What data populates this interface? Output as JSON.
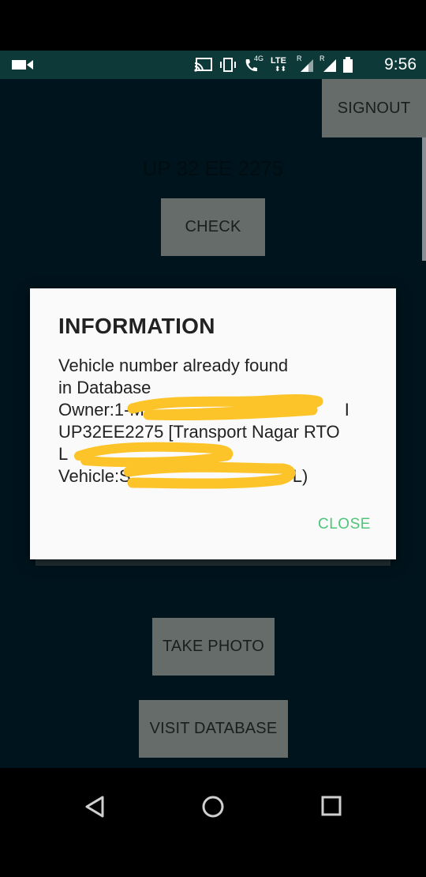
{
  "status_bar": {
    "time": "9:56",
    "icons": [
      "video-camera-icon",
      "cast-icon",
      "vibrate-icon",
      "call-4g-icon",
      "lte-icon",
      "signal-icon",
      "signal-icon",
      "battery-icon"
    ],
    "network_labels": {
      "call": "4G",
      "lte": "LTE",
      "roaming1": "R",
      "roaming2": "R"
    }
  },
  "header": {
    "signout_label": "SIGNOUT"
  },
  "form": {
    "vehicle_number": "UP 32 EE 2275",
    "check_label": "CHECK"
  },
  "dialog": {
    "title": "INFORMATION",
    "lines": [
      "Vehicle number already found",
      "in Database",
      "Owner:1-M",
      "UP32EE2275 [Transport Nagar RTO",
      "L",
      "Vehicle:S"
    ],
    "owner_tail": "I",
    "vehicle_tail": "L)",
    "close_label": "CLOSE"
  },
  "actions": {
    "take_photo_label": "TAKE PHOTO",
    "visit_database_label": "VISIT DATABASE"
  },
  "nav_bar": {
    "back": "back-triangle-icon",
    "home": "home-circle-icon",
    "recents": "recents-square-icon"
  },
  "colors": {
    "status_bar": "#0d3a38",
    "app_background": "#00141d",
    "button": "#656c69",
    "dialog": "#fafafa",
    "close_text": "#4fc47a",
    "redaction": "#fdc42a"
  }
}
